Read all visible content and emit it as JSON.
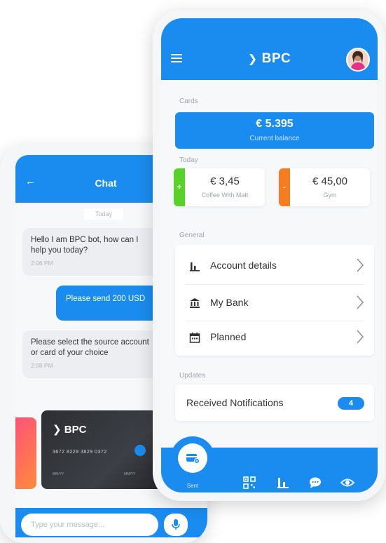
{
  "chat": {
    "title": "Chat",
    "day": "Today",
    "messages": [
      {
        "from": "bot",
        "text": "Hello I am BPC bot, how can I help you today?",
        "time": "2:06 PM"
      },
      {
        "from": "user",
        "text": "Please send 200 USD"
      },
      {
        "from": "bot",
        "text": "Please select the source account or card of your choice",
        "time": "2:08 PM"
      }
    ],
    "card": {
      "brand": "BPC",
      "number": "3672 8229 3829 0372",
      "exp_left": "MM/YY",
      "exp_right": "MM/YY"
    },
    "input_placeholder": "Type your message..."
  },
  "main": {
    "brand": "BPC",
    "sections": {
      "cards": "Cards",
      "today": "Today",
      "general": "General",
      "updates": "Updates"
    },
    "balance": {
      "amount": "€ 5.395",
      "caption": "Current balance"
    },
    "today": [
      {
        "sign": "+",
        "amount": "€ 3,45",
        "desc": "Coffee With Matt",
        "color": "#5ad12a"
      },
      {
        "sign": "-",
        "amount": "€ 45,00",
        "desc": "Gym",
        "color": "#f57c1f"
      }
    ],
    "general": [
      {
        "label": "Account details",
        "icon": "bar-chart-icon"
      },
      {
        "label": "My Bank",
        "icon": "bank-icon"
      },
      {
        "label": "Planned",
        "icon": "calendar-icon"
      }
    ],
    "notifications": {
      "label": "Received Notifications",
      "count": "4"
    },
    "nav": {
      "sent_label": "Sent",
      "icons": [
        "qr-code-icon",
        "bar-chart-icon",
        "chat-bubble-icon",
        "eye-icon"
      ]
    }
  },
  "colors": {
    "primary": "#1a8cf0",
    "income": "#5ad12a",
    "expense": "#f57c1f"
  }
}
